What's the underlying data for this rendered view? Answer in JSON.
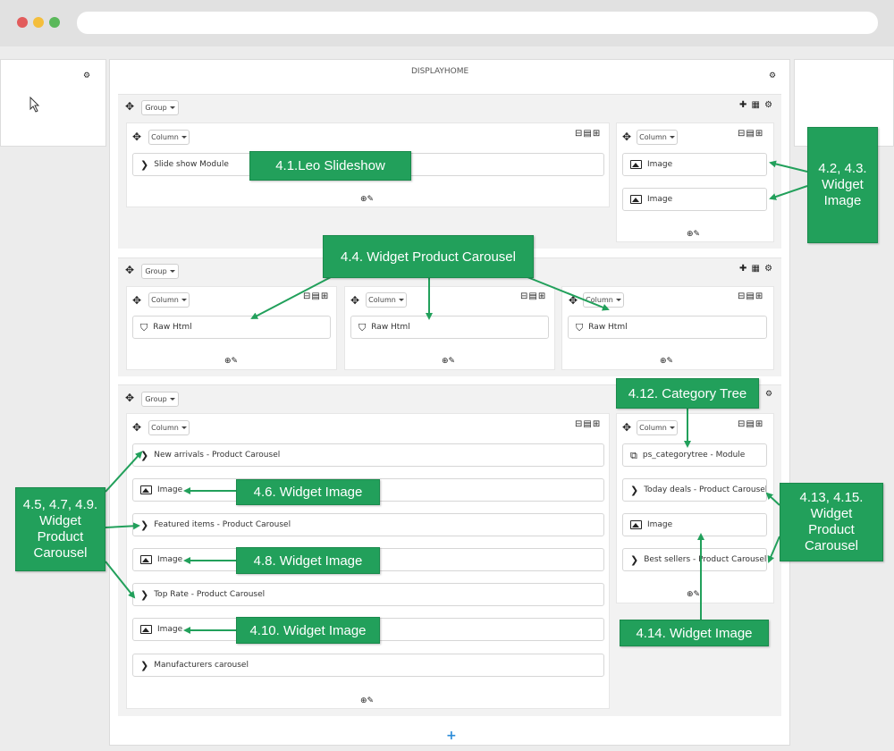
{
  "browser": {
    "dots": [
      "#e25c5c",
      "#f4be3c",
      "#5bb85b"
    ]
  },
  "page": {
    "hook_title": "DISPLAYHOME",
    "add_symbol": "+"
  },
  "labels": {
    "group": "Group",
    "column": "Column"
  },
  "modules": {
    "slideshow": "Slide show Module",
    "image": "Image",
    "raw_html": "Raw Html",
    "new_arrivals": "New arrivals - Product Carousel",
    "featured": "Featured items - Product Carousel",
    "top_rate": "Top Rate - Product Carousel",
    "manufacturers": "Manufacturers carousel",
    "category_tree": "ps_categorytree - Module",
    "today_deals": "Today deals - Product Carousel",
    "best_sellers": "Best sellers - Product Carousel"
  },
  "callouts": {
    "leo_slideshow": "4.1.Leo Slideshow",
    "widget_image_23": "4.2, 4.3.\nWidget\nImage",
    "product_carousel_44": "4.4. Widget Product Carousel",
    "category_tree": "4.12. Category Tree",
    "carousel_left": "4.5, 4.7, 4.9.\nWidget\nProduct\nCarousel",
    "widget_image_46": "4.6. Widget Image",
    "widget_image_48": "4.8. Widget Image",
    "widget_image_410": "4.10. Widget Image",
    "carousel_right": "4.13, 4.15.\nWidget\nProduct\nCarousel",
    "widget_image_414": "4.14. Widget Image"
  },
  "colors": {
    "callout_green": "#22a05b",
    "add_blue": "#2b8bd8"
  }
}
